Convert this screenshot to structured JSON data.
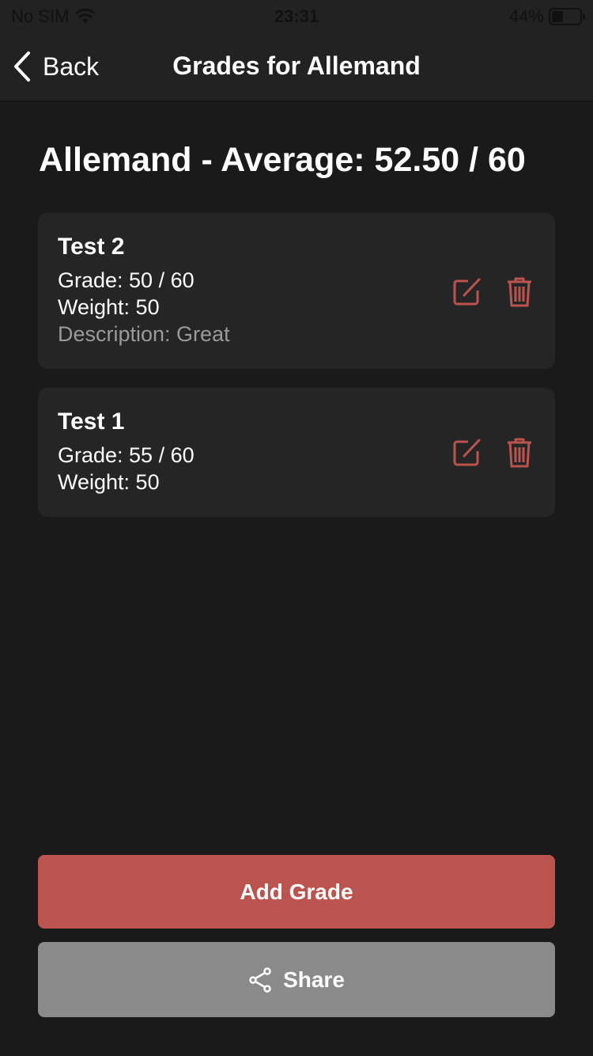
{
  "status_bar": {
    "carrier": "No SIM",
    "time": "23:31",
    "battery": "44%",
    "battery_level": 0.44
  },
  "nav": {
    "back_label": "Back",
    "title": "Grades for Allemand"
  },
  "heading": "Allemand - Average: 52.50 / 60",
  "grades": [
    {
      "name": "Test 2",
      "grade": "Grade: 50 / 60",
      "weight": "Weight: 50",
      "description": "Description: Great"
    },
    {
      "name": "Test 1",
      "grade": "Grade: 55 / 60",
      "weight": "Weight: 50"
    }
  ],
  "buttons": {
    "add": "Add Grade",
    "share": "Share"
  },
  "colors": {
    "accent": "#bb534f",
    "share": "#8a8a8a",
    "background": "#1a1a1a",
    "card": "#252525"
  },
  "icons": {
    "edit": "edit-icon",
    "delete": "trash-icon",
    "share": "share-icon",
    "back": "chevron-left-icon"
  }
}
